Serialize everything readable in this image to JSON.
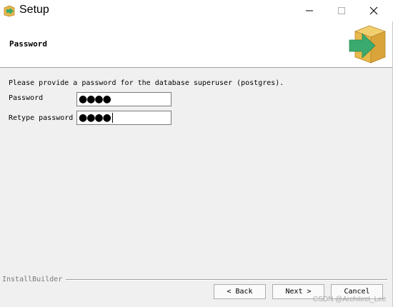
{
  "window": {
    "title": "Setup",
    "controls": {
      "minimize": "minimize",
      "maximize": "maximize",
      "close": "close"
    }
  },
  "header": {
    "page_title": "Password",
    "logo_icon": "install-box-arrow-icon"
  },
  "form": {
    "instruction": "Please provide a password for the database superuser (postgres).",
    "password_label": "Password",
    "password_value_masked": "●●●●",
    "retype_label": "Retype password",
    "retype_value_masked": "●●●●"
  },
  "footer": {
    "brand": "InstallBuilder",
    "back_label": "< Back",
    "next_label": "Next >",
    "cancel_label": "Cancel"
  },
  "watermark": "CSDN @Architect_Lee",
  "colors": {
    "window_bg": "#f0f0f0",
    "header_bg": "#ffffff",
    "logo_box": "#e8b84a",
    "logo_arrow": "#3aaa6e"
  }
}
